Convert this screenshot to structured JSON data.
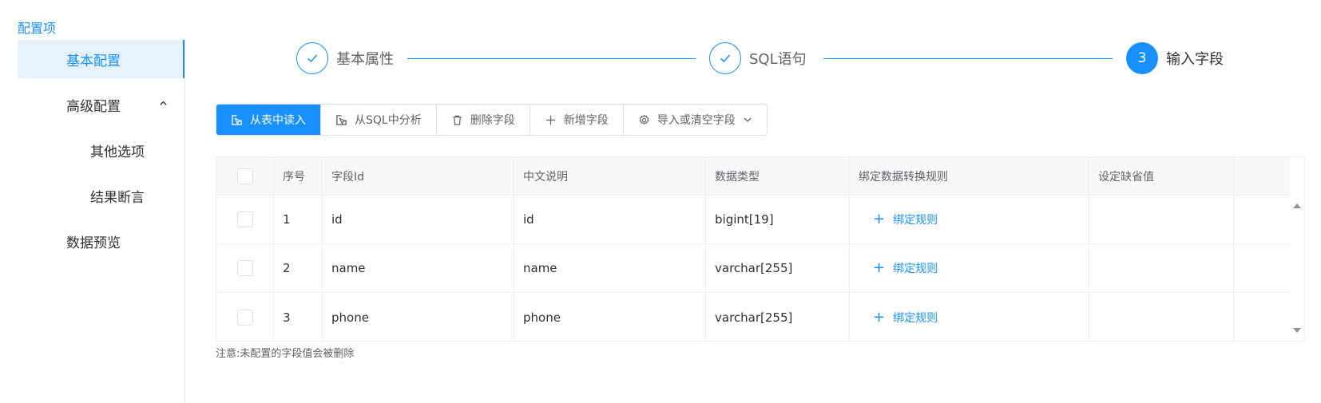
{
  "sidebar": {
    "title": "配置项",
    "items": [
      {
        "label": "基本配置"
      },
      {
        "label": "高级配置"
      },
      {
        "label": "其他选项"
      },
      {
        "label": "结果断言"
      },
      {
        "label": "数据预览"
      }
    ]
  },
  "steps": [
    {
      "label": "基本属性",
      "status": "finished",
      "icon": "check-icon"
    },
    {
      "label": "SQL语句",
      "status": "finished",
      "icon": "check-icon"
    },
    {
      "label": "输入字段",
      "status": "current",
      "number": "3"
    }
  ],
  "toolbar": {
    "read_from_table": "从表中读入",
    "analyze_sql": "从SQL中分析",
    "delete_field": "删除字段",
    "add_field": "新增字段",
    "import_or_clear": "导入或清空字段"
  },
  "table": {
    "columns": [
      "序号",
      "字段Id",
      "中文说明",
      "数据类型",
      "绑定数据转换规则",
      "设定缺省值"
    ],
    "bind_rule_label": "绑定规则",
    "rows": [
      {
        "index": "1",
        "field_id": "id",
        "description": "id",
        "data_type": "bigint[19]",
        "default": ""
      },
      {
        "index": "2",
        "field_id": "name",
        "description": "name",
        "data_type": "varchar[255]",
        "default": ""
      },
      {
        "index": "3",
        "field_id": "phone",
        "description": "phone",
        "data_type": "varchar[255]",
        "default": ""
      }
    ]
  },
  "note": "注意:未配置的字段值会被删除",
  "colors": {
    "accent": "#1890ff",
    "active_bg": "#e6f3ff",
    "border": "#ebeef5"
  }
}
